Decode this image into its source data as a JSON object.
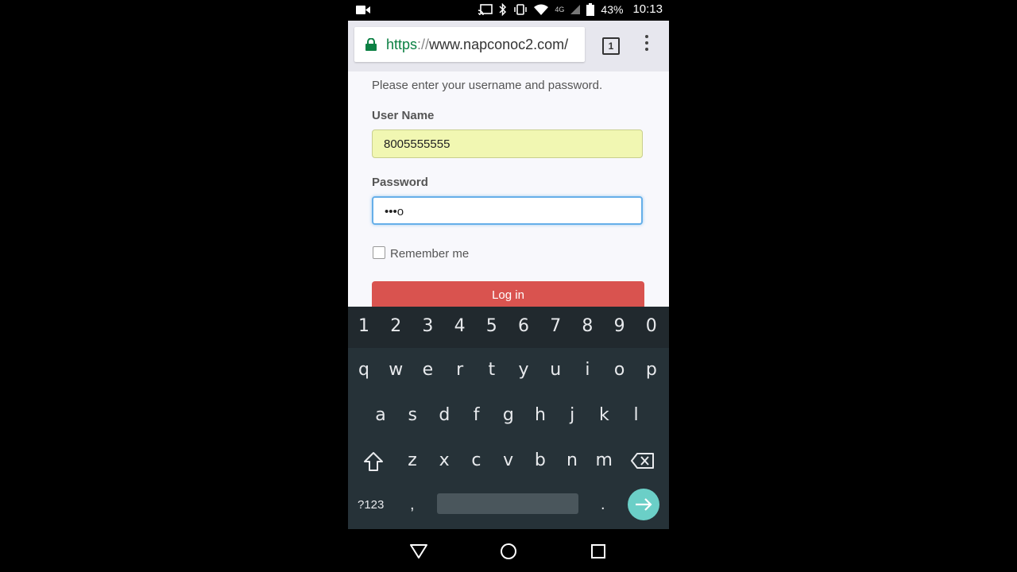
{
  "status_bar": {
    "battery": "43%",
    "time": "10:13",
    "network": "4G"
  },
  "browser": {
    "url_scheme": "https",
    "url_separator": "://",
    "url_host": "www.napconoc2.com/",
    "tab_count": "1"
  },
  "page": {
    "instructions": "Please enter your username and password.",
    "username_label": "User Name",
    "username_value": "8005555555",
    "password_label": "Password",
    "password_value": "•••o",
    "remember_label": "Remember me",
    "login_label": "Log in"
  },
  "keyboard": {
    "numbers": [
      "1",
      "2",
      "3",
      "4",
      "5",
      "6",
      "7",
      "8",
      "9",
      "0"
    ],
    "row1": [
      "q",
      "w",
      "e",
      "r",
      "t",
      "y",
      "u",
      "i",
      "o",
      "p"
    ],
    "row2": [
      "a",
      "s",
      "d",
      "f",
      "g",
      "h",
      "j",
      "k",
      "l"
    ],
    "row3": [
      "z",
      "x",
      "c",
      "v",
      "b",
      "n",
      "m"
    ],
    "mode_label": "?123",
    "comma": ",",
    "period": "."
  },
  "icons": {
    "lock": "lock-icon",
    "video": "video-record-icon",
    "back": "back-triangle-icon",
    "home": "home-circle-icon",
    "recents": "recents-square-icon"
  },
  "colors": {
    "login_button": "#d9534f",
    "autofill_field": "#f1f7b2",
    "focus_border": "#66afe9",
    "keyboard_bg": "#263238",
    "enter_key": "#6bcfc7",
    "url_scheme": "#0b8043"
  }
}
